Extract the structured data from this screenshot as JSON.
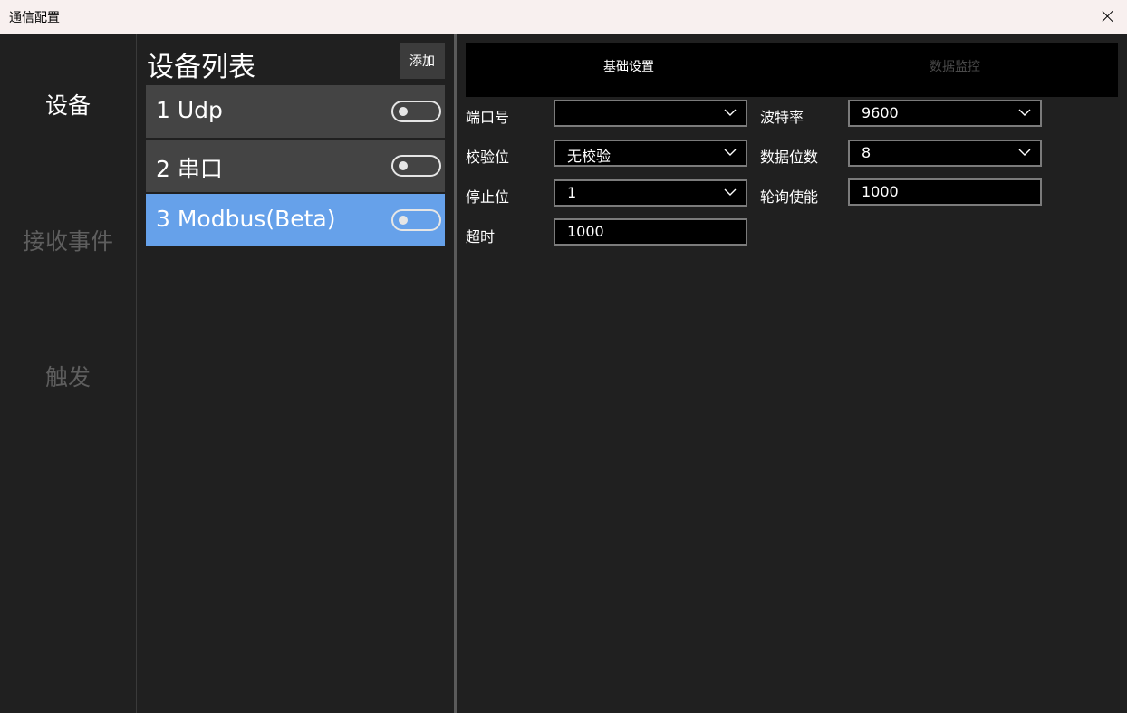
{
  "window": {
    "title": "通信配置"
  },
  "nav": {
    "items": [
      {
        "label": "设备",
        "active": true
      },
      {
        "label": "接收事件",
        "active": false
      },
      {
        "label": "触发",
        "active": false
      }
    ]
  },
  "device_list": {
    "title": "设备列表",
    "add_label": "添加",
    "items": [
      {
        "label": "1 Udp",
        "enabled": false,
        "selected": false
      },
      {
        "label": "2 串口",
        "enabled": false,
        "selected": false
      },
      {
        "label": "3 Modbus(Beta)",
        "enabled": false,
        "selected": true
      }
    ]
  },
  "tabs": [
    {
      "label": "基础设置",
      "active": true
    },
    {
      "label": "数据监控",
      "active": false
    }
  ],
  "form": {
    "port": {
      "label": "端口号",
      "value": ""
    },
    "baud": {
      "label": "波特率",
      "value": "9600"
    },
    "parity": {
      "label": "校验位",
      "value": "无校验"
    },
    "databits": {
      "label": "数据位数",
      "value": "8"
    },
    "stopbits": {
      "label": "停止位",
      "value": "1"
    },
    "poll": {
      "label": "轮询使能",
      "value": "1000"
    },
    "timeout": {
      "label": "超时",
      "value": "1000"
    }
  },
  "colors": {
    "selected_item": "#66a1ea",
    "background": "#202020",
    "titlebar": "#f8f0ef"
  }
}
